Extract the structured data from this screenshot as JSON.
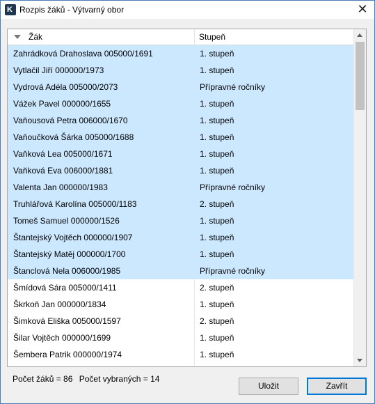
{
  "window": {
    "title": "Rozpis žáků - Výtvarný obor",
    "close_glyph": "✕",
    "app_icon_letter": "K"
  },
  "table": {
    "columns": [
      "Žák",
      "Stupeň"
    ],
    "rows": [
      {
        "name": "Zahrádková Drahoslava 005000/1691",
        "level": "1. stupeň",
        "selected": true
      },
      {
        "name": "Vytlačil Jiří 000000/1973",
        "level": "1. stupeň",
        "selected": true
      },
      {
        "name": "Vydrová Adéla 005000/2073",
        "level": "Přípravné ročníky",
        "selected": true
      },
      {
        "name": "Vážek Pavel 000000/1655",
        "level": "1. stupeň",
        "selected": true
      },
      {
        "name": "Vaňousová Petra 006000/1670",
        "level": "1. stupeň",
        "selected": true
      },
      {
        "name": "Vaňoučková Šárka 005000/1688",
        "level": "1. stupeň",
        "selected": true
      },
      {
        "name": "Vaňková Lea 005000/1671",
        "level": "1. stupeň",
        "selected": true
      },
      {
        "name": "Vaňková Eva 006000/1881",
        "level": "1. stupeň",
        "selected": true
      },
      {
        "name": "Valenta Jan 000000/1983",
        "level": "Přípravné ročníky",
        "selected": true
      },
      {
        "name": "Truhlářová Karolína 005000/1183",
        "level": "2. stupeň",
        "selected": true
      },
      {
        "name": "Tomeš Samuel 000000/1526",
        "level": "1. stupeň",
        "selected": true
      },
      {
        "name": "Štantejský Vojtěch 000000/1907",
        "level": "1. stupeň",
        "selected": true
      },
      {
        "name": "Štantejský Matěj 000000/1700",
        "level": "1. stupeň",
        "selected": true
      },
      {
        "name": "Štanclová Nela 006000/1985",
        "level": "Přípravné ročníky",
        "selected": true
      },
      {
        "name": "Šmídová Sára 005000/1411",
        "level": "2. stupeň",
        "selected": false
      },
      {
        "name": "Škrkoň Jan 000000/1834",
        "level": "1. stupeň",
        "selected": false
      },
      {
        "name": "Šimková Eliška 005000/1597",
        "level": "2. stupeň",
        "selected": false
      },
      {
        "name": "Šilar Vojtěch 000000/1699",
        "level": "1. stupeň",
        "selected": false
      },
      {
        "name": "Šembera Patrik 000000/1974",
        "level": "1. stupeň",
        "selected": false
      }
    ],
    "sort_icon": "sort-descending-icon",
    "selection_color": "#cce8ff"
  },
  "status": {
    "count_text": "Počet žáků = 86",
    "selected_text": "Počet vybraných = 14"
  },
  "buttons": {
    "save_label": "Uložit",
    "close_label": "Zavřít"
  },
  "colors": {
    "window_border": "#4a7db8",
    "accent": "#0078d7"
  }
}
